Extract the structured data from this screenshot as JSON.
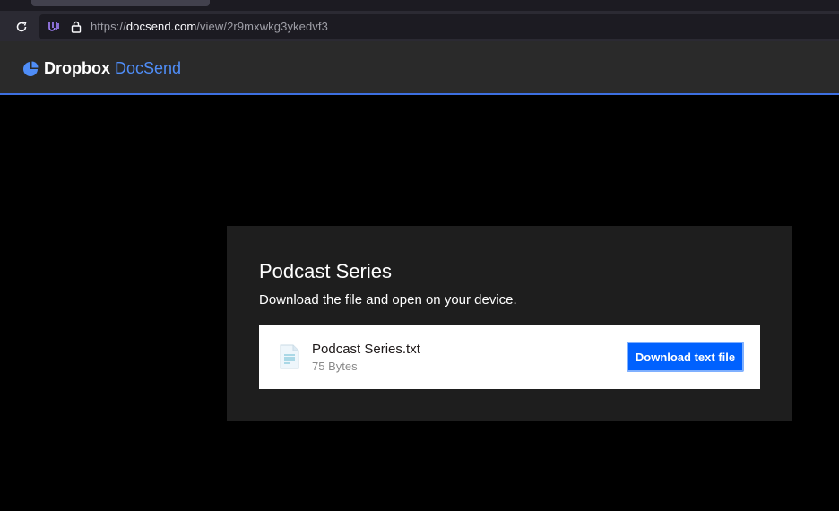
{
  "browser": {
    "url_scheme": "https://",
    "url_host": "docsend.com",
    "url_path": "/view/2r9mxwkg3ykedvf3"
  },
  "header": {
    "logo_brand": "Dropbox",
    "logo_product": "DocSend"
  },
  "card": {
    "title": "Podcast Series",
    "subtitle": "Download the file and open on your device.",
    "file": {
      "name": "Podcast Series.txt",
      "size": "75 Bytes",
      "icon": "text-file-icon"
    },
    "download_label": "Download text file"
  },
  "colors": {
    "accent": "#0061fe",
    "brand_blue": "#4f8df7",
    "header_bg": "#2a2a2a",
    "card_bg": "#1e1e1e"
  }
}
